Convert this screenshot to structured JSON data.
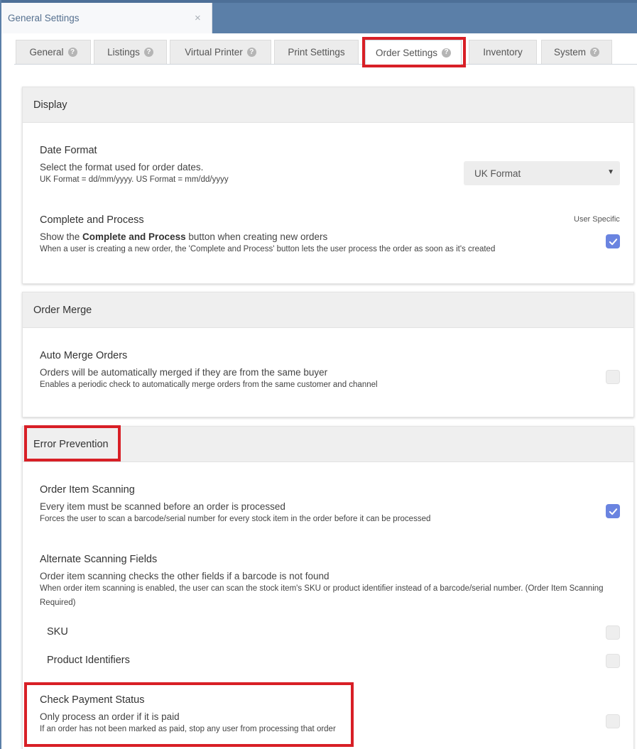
{
  "window": {
    "title": "General Settings",
    "close_glyph": "×"
  },
  "tabs": [
    {
      "label": "General",
      "help": true
    },
    {
      "label": "Listings",
      "help": true
    },
    {
      "label": "Virtual Printer",
      "help": true
    },
    {
      "label": "Print Settings",
      "help": false
    },
    {
      "label": "Order Settings",
      "help": true,
      "active": true
    },
    {
      "label": "Inventory",
      "help": false
    },
    {
      "label": "System",
      "help": true
    }
  ],
  "help_glyph": "?",
  "display": {
    "header": "Display",
    "date_format": {
      "title": "Date Format",
      "desc": "Select the format used for order dates.",
      "note": "UK Format = dd/mm/yyyy. US Format = mm/dd/yyyy",
      "selected": "UK Format",
      "arrow": "▼"
    },
    "complete_process": {
      "title": "Complete and Process",
      "desc_pre": "Show the ",
      "desc_bold": "Complete and Process",
      "desc_post": " button when creating new orders",
      "note": "When a user is creating a new order, the 'Complete and Process' button lets the user process the order as soon as it's created",
      "badge": "User Specific",
      "checked": true
    }
  },
  "order_merge": {
    "header": "Order Merge",
    "auto_merge": {
      "title": "Auto Merge Orders",
      "desc": "Orders will be automatically merged if they are from the same buyer",
      "note": "Enables a periodic check to automatically merge orders from the same customer and channel",
      "checked": false
    }
  },
  "error_prevention": {
    "header": "Error Prevention",
    "item_scanning": {
      "title": "Order Item Scanning",
      "desc": "Every item must be scanned before an order is processed",
      "note": "Forces the user to scan a barcode/serial number for every stock item in the order before it can be processed",
      "checked": true
    },
    "alternate_fields": {
      "title": "Alternate Scanning Fields",
      "desc": "Order item scanning checks the other fields if a barcode is not found",
      "note": "When order item scanning is enabled, the user can scan the stock item's SKU or product identifier instead of a barcode/serial number. (Order Item Scanning Required)",
      "options": [
        {
          "label": "SKU",
          "checked": false
        },
        {
          "label": "Product Identifiers",
          "checked": false
        }
      ]
    },
    "payment_status": {
      "title": "Check Payment Status",
      "desc": "Only process an order if it is paid",
      "note": "If an order has not been marked as paid, stop any user from processing that order",
      "checked": false
    }
  },
  "colors": {
    "accent": "#6a84e0",
    "highlight": "#d81f26",
    "topbar": "#5b7fa8"
  }
}
